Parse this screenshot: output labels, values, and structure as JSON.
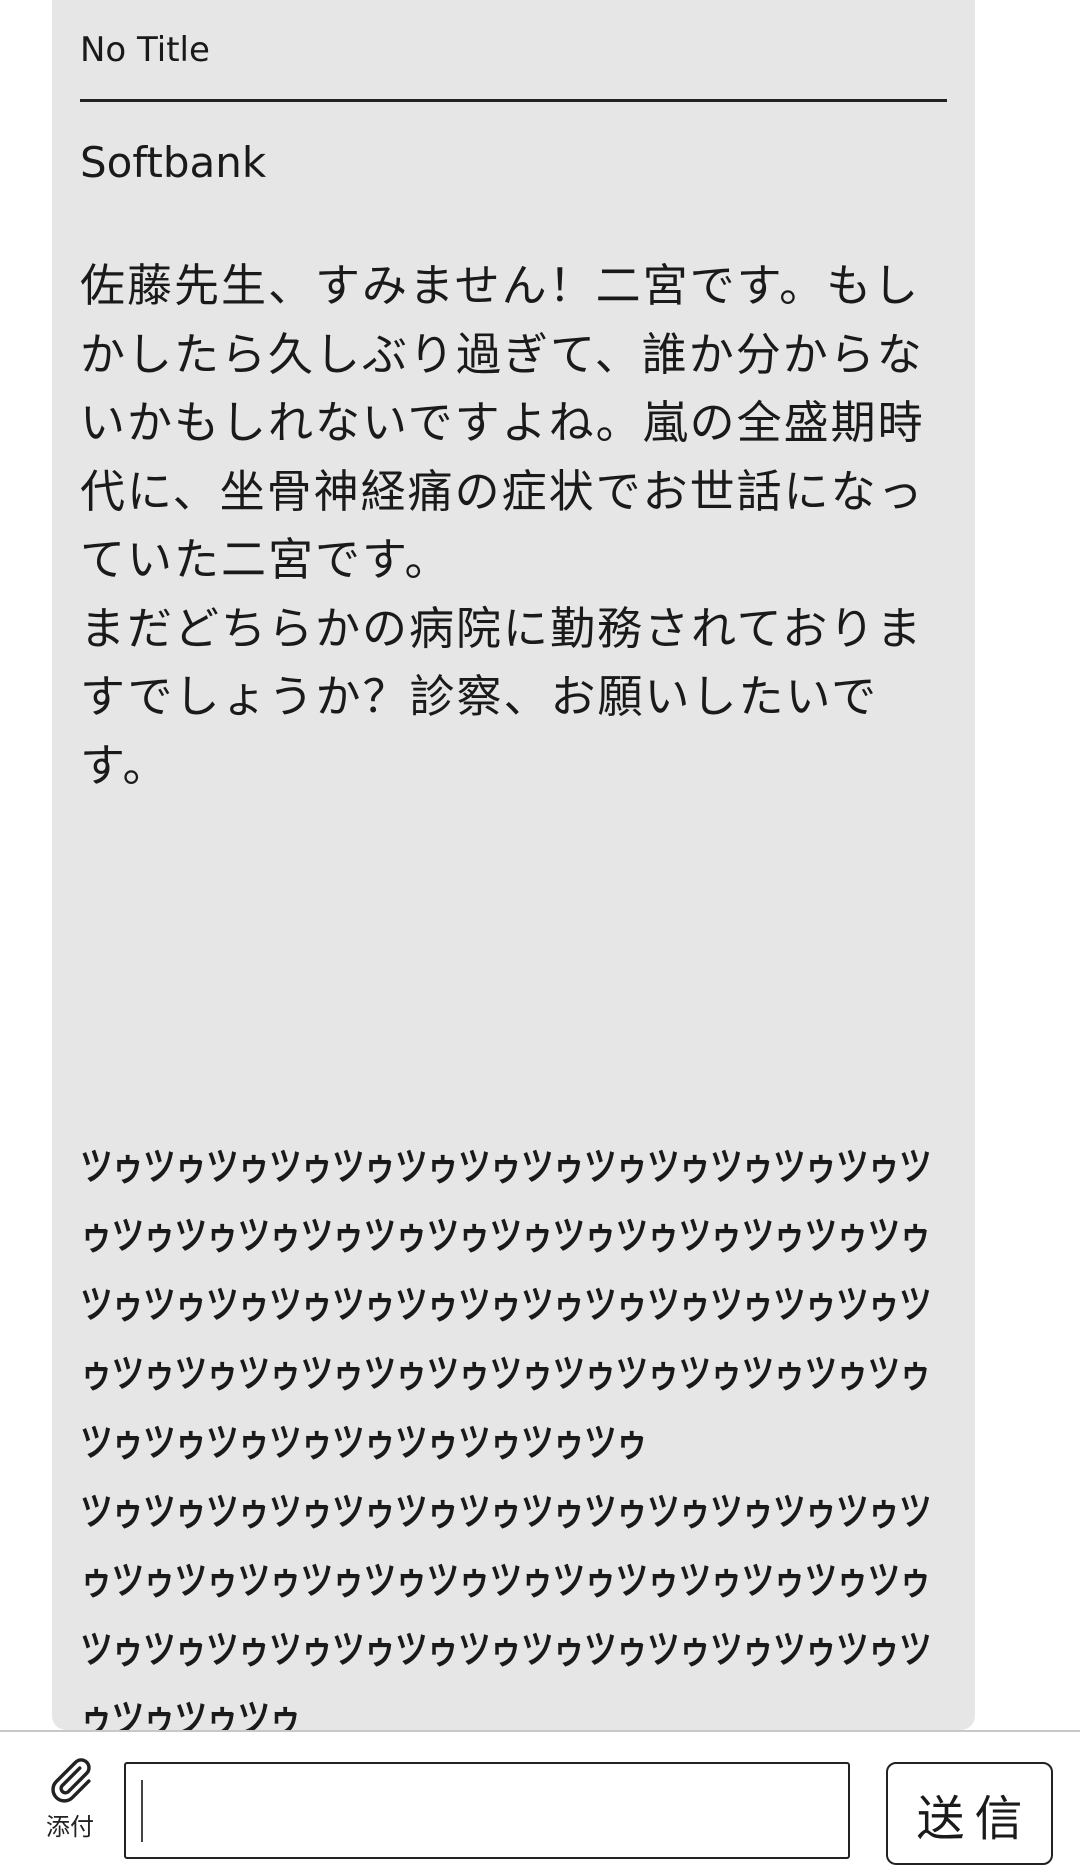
{
  "message": {
    "title": "No Title",
    "sender": "Softbank",
    "body": "佐藤先生、すみません！二宮です。もしかしたら久しぶり過ぎて、誰か分からないかもしれないですよね。嵐の全盛期時代に、坐骨神経痛の症状でお世話になっていた二宮です。\nまだどちらかの病院に勤務されておりますでしょうか？診察、お願いしたいです。",
    "katakana_text": "ツゥツゥツゥツゥツゥツゥツゥツゥツゥツゥツゥツゥツゥツゥツゥツゥツゥツゥツゥツゥツゥツゥツゥツゥツゥツゥツゥツゥツゥツゥツゥツゥツゥツゥツゥツゥツゥツゥツゥツゥツゥツゥツゥツゥツゥツゥツゥツゥツゥツゥツゥツゥツゥツゥツゥツゥツゥツゥツゥツゥツゥツゥツゥ\nツゥツゥツゥツゥツゥツゥツゥツゥツゥツゥツゥツゥツゥツゥツゥツゥツゥツゥツゥツゥツゥツゥツゥツゥツゥツゥツゥツゥツゥツゥツゥツゥツゥツゥツゥツゥツゥツゥツゥツゥツゥツゥツゥツゥ"
  },
  "composer": {
    "attach_label": "添付",
    "input_value": "",
    "send_label": "送信"
  },
  "icons": {
    "attach": "paperclip-icon"
  }
}
